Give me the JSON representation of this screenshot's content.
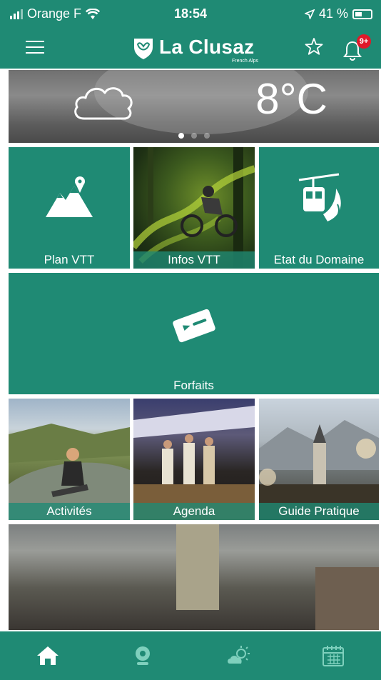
{
  "status_bar": {
    "carrier": "Orange F",
    "time": "18:54",
    "battery": "41 %"
  },
  "header": {
    "logo_text": "La Clusaz",
    "logo_subtitle": "French Alps",
    "notification_count": "9+"
  },
  "weather": {
    "temperature": "8°C",
    "icon": "cloud-icon",
    "slides": 3,
    "active_slide": 1
  },
  "tiles": {
    "plan_vtt": "Plan VTT",
    "infos_vtt": "Infos VTT",
    "etat_domaine": "Etat du Domaine",
    "forfaits": "Forfaits",
    "activites": "Activités",
    "agenda": "Agenda",
    "guide_pratique": "Guide Pratique"
  },
  "bottom_nav": [
    "home-icon",
    "webcam-icon",
    "weather-icon",
    "calendar-icon"
  ],
  "colors": {
    "brand": "#1f8a74",
    "badge": "#e0192a"
  }
}
